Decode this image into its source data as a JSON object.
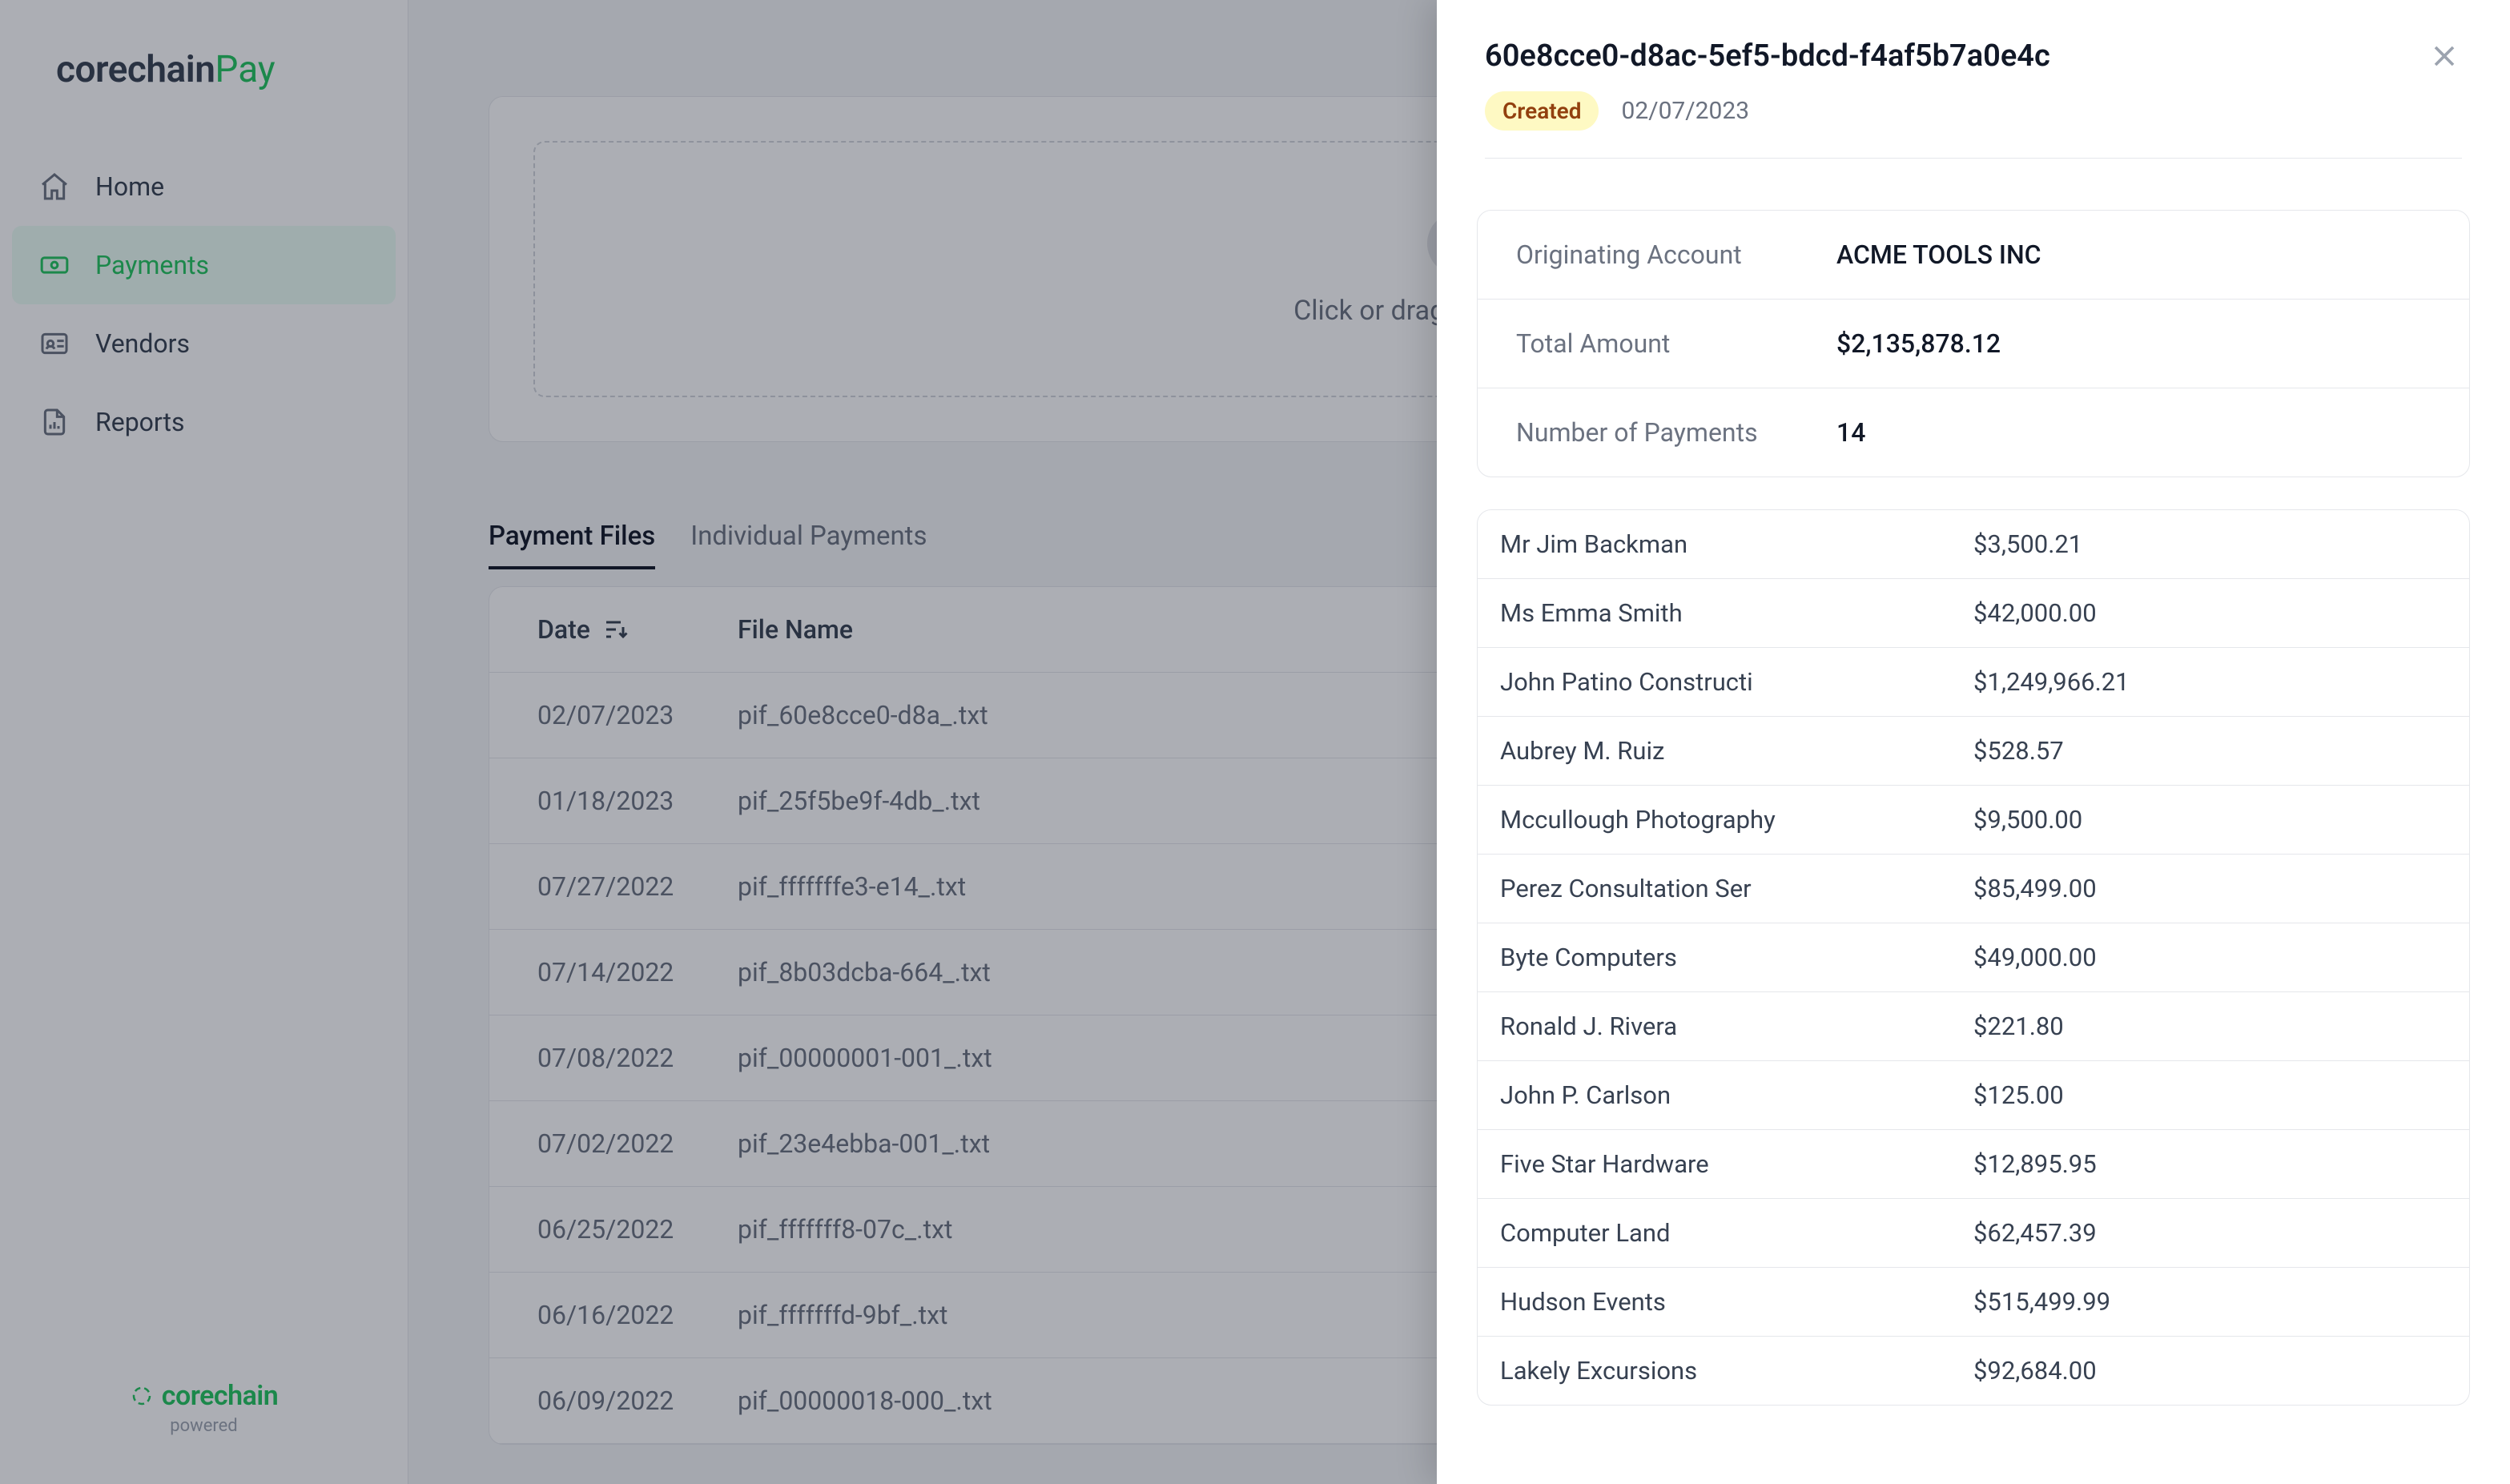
{
  "brand": {
    "main": "corechain",
    "accent": "Pay",
    "footer_main": "corechain",
    "footer_sub": "powered"
  },
  "nav": {
    "items": [
      {
        "label": "Home"
      },
      {
        "label": "Payments"
      },
      {
        "label": "Vendors"
      },
      {
        "label": "Reports"
      }
    ]
  },
  "upload": {
    "hint": "Click or drag here to upload"
  },
  "tabs": {
    "payment_files": "Payment Files",
    "individual_payments": "Individual Payments"
  },
  "table": {
    "headers": {
      "date": "Date",
      "file_name": "File Name"
    },
    "rows": [
      {
        "date": "02/07/2023",
        "name": "pif_60e8cce0-d8a_.txt"
      },
      {
        "date": "01/18/2023",
        "name": "pif_25f5be9f-4db_.txt"
      },
      {
        "date": "07/27/2022",
        "name": "pif_fffffffe3-e14_.txt"
      },
      {
        "date": "07/14/2022",
        "name": "pif_8b03dcba-664_.txt"
      },
      {
        "date": "07/08/2022",
        "name": "pif_00000001-001_.txt"
      },
      {
        "date": "07/02/2022",
        "name": "pif_23e4ebba-001_.txt"
      },
      {
        "date": "06/25/2022",
        "name": "pif_fffffff8-07c_.txt"
      },
      {
        "date": "06/16/2022",
        "name": "pif_fffffffd-9bf_.txt"
      },
      {
        "date": "06/09/2022",
        "name": "pif_00000018-000_.txt"
      }
    ]
  },
  "panel": {
    "title": "60e8cce0-d8ac-5ef5-bdcd-f4af5b7a0e4c",
    "badge": "Created",
    "date": "02/07/2023",
    "info": {
      "originating_label": "Originating Account",
      "originating_value": "ACME TOOLS INC",
      "total_label": "Total Amount",
      "total_value": "$2,135,878.12",
      "count_label": "Number of Payments",
      "count_value": "14"
    },
    "payments": [
      {
        "name": "Mr Jim Backman",
        "amount": "$3,500.21"
      },
      {
        "name": "Ms Emma Smith",
        "amount": "$42,000.00"
      },
      {
        "name": "John Patino Constructi",
        "amount": "$1,249,966.21"
      },
      {
        "name": "Aubrey M. Ruiz",
        "amount": "$528.57"
      },
      {
        "name": "Mccullough Photography",
        "amount": "$9,500.00"
      },
      {
        "name": "Perez Consultation Ser",
        "amount": "$85,499.00"
      },
      {
        "name": "Byte Computers",
        "amount": "$49,000.00"
      },
      {
        "name": "Ronald J. Rivera",
        "amount": "$221.80"
      },
      {
        "name": "John P. Carlson",
        "amount": "$125.00"
      },
      {
        "name": "Five Star Hardware",
        "amount": "$12,895.95"
      },
      {
        "name": "Computer Land",
        "amount": "$62,457.39"
      },
      {
        "name": "Hudson Events",
        "amount": "$515,499.99"
      },
      {
        "name": "Lakely Excursions",
        "amount": "$92,684.00"
      }
    ]
  }
}
